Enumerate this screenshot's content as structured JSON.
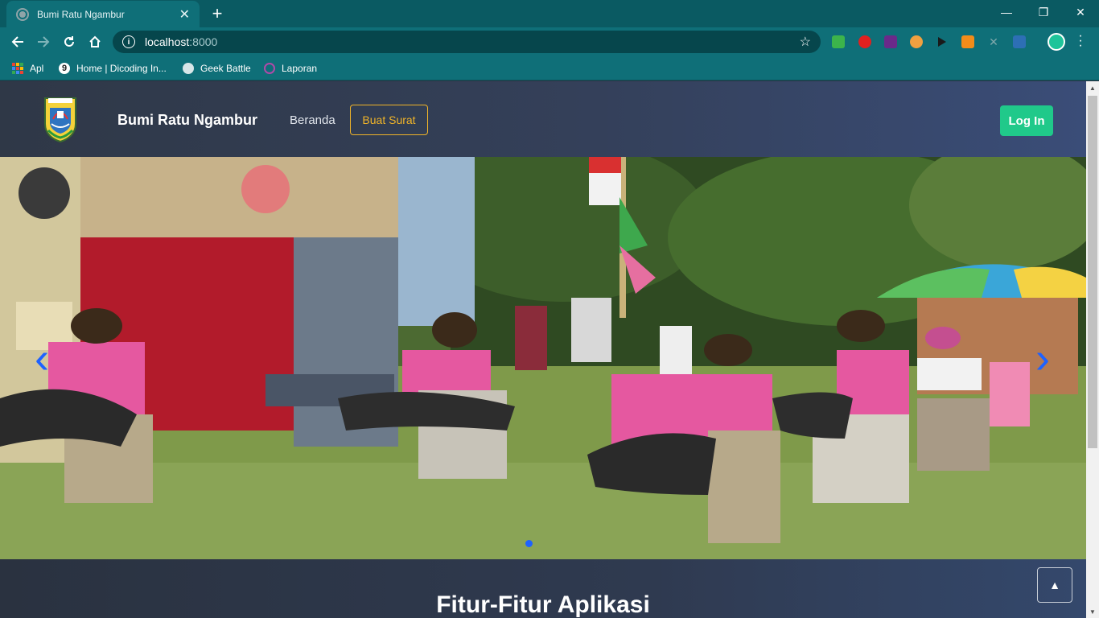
{
  "browser": {
    "tab_title": "Bumi Ratu Ngambur",
    "tab_close": "✕",
    "new_tab": "+",
    "window_controls": {
      "minimize": "—",
      "maximize": "❐",
      "close": "✕"
    },
    "url_host": "localhost",
    "url_port": ":8000",
    "bookmarks": [
      {
        "label": "Apl",
        "icon": "apps-grid-icon"
      },
      {
        "label": "Home | Dicoding In...",
        "icon": "dicoding-icon"
      },
      {
        "label": "Geek Battle",
        "icon": "globe-icon"
      },
      {
        "label": "Laporan",
        "icon": "circle-icon"
      }
    ],
    "accent_color": "#0f6f78"
  },
  "site": {
    "brand": "Bumi Ratu Ngambur",
    "nav": {
      "home": "Beranda",
      "make_letter": "Buat Surat",
      "login": "Log In"
    },
    "carousel": {
      "prev_icon": "‹",
      "next_icon": "›",
      "active_index": 0
    },
    "features_title": "Fitur-Fitur Aplikasi",
    "back_to_top_icon": "▲",
    "colors": {
      "login": "#20c98a",
      "outline": "#f0b429",
      "carousel_control": "#1e62ff"
    }
  }
}
